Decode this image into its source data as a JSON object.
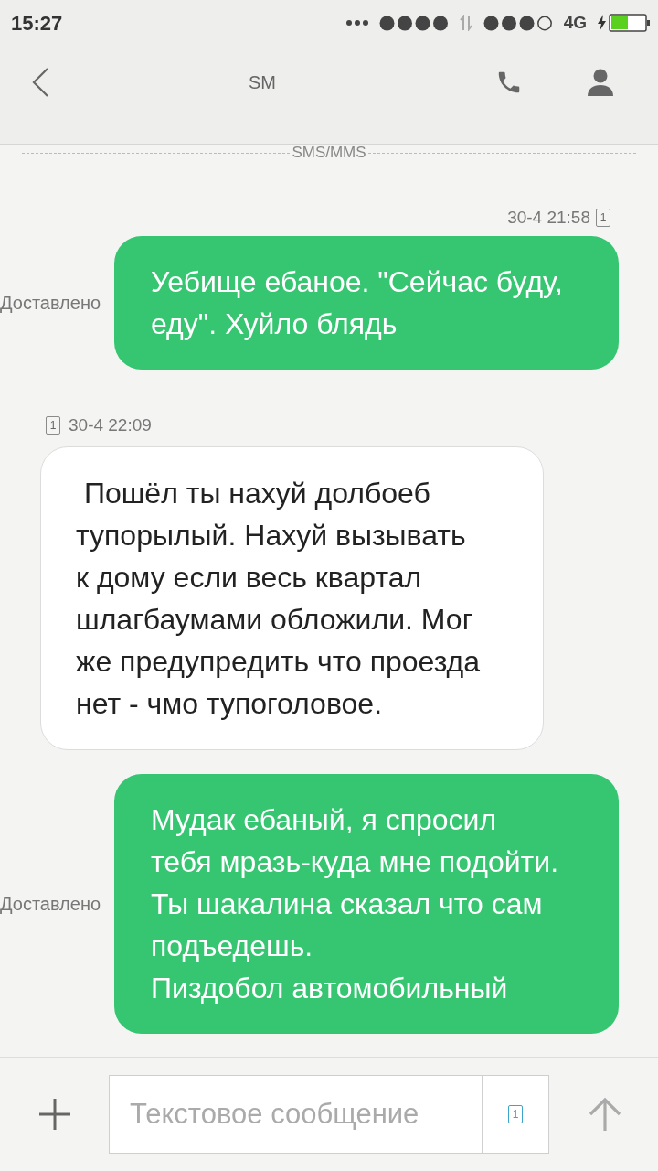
{
  "status_bar": {
    "time": "15:27",
    "network": "4G"
  },
  "header": {
    "title": "SM"
  },
  "divider": {
    "label": "SMS/MMS"
  },
  "messages": [
    {
      "kind": "sent",
      "time": "30-4 21:58",
      "sim": "1",
      "status": "Доставлено",
      "text": "Уебище ебаное. \"Сейчас буду, еду\". Хуйло блядь"
    },
    {
      "kind": "received",
      "time": "30-4 22:09",
      "sim": "1",
      "text": " Пошёл ты нахуй долбоеб тупорылый. Нахуй вызывать к дому если весь квартал шлагбаумами обложили. Мог же предупредить что проезда нет - чмо тупоголовое."
    },
    {
      "kind": "sent",
      "status": "Доставлено",
      "text": "Мудак ебаный, я спросил тебя мразь-куда мне подойти. Ты шакалина сказал что сам подъедешь.\nПиздобол автомобильный"
    }
  ],
  "composer": {
    "placeholder": "Текстовое сообщение",
    "sim": "1"
  }
}
